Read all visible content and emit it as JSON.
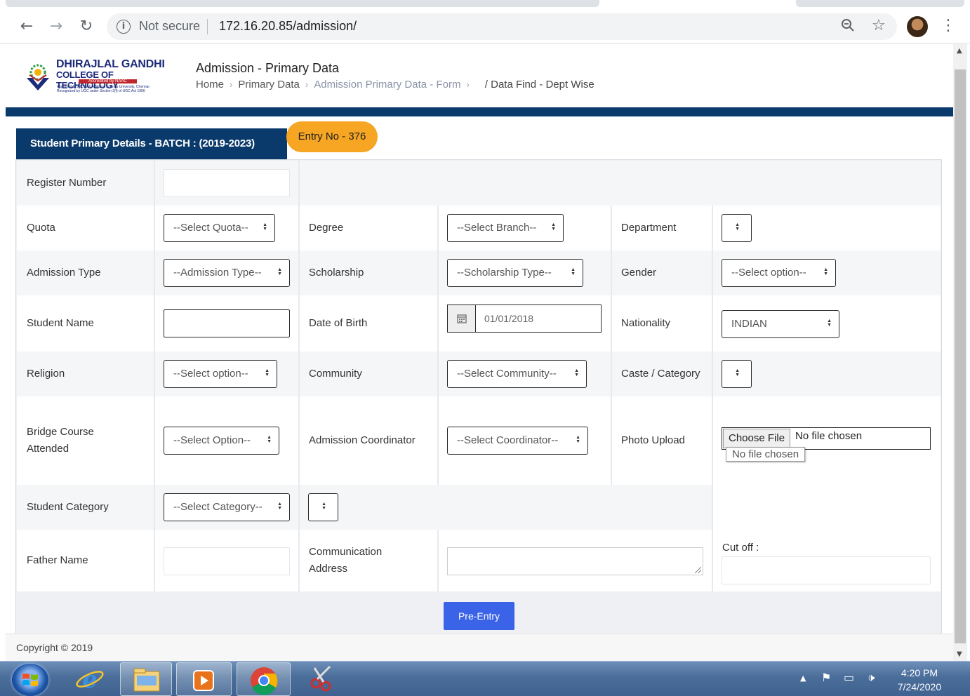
{
  "browser": {
    "security_label": "Not secure",
    "url": "172.16.20.85/admission/"
  },
  "header": {
    "logo": {
      "line1": "DHIRAJLAL GANDHI",
      "line2": "COLLEGE OF TECHNOLOGY",
      "badge": "Accredited by NAAC",
      "fine1": "Approved by AICTE & Affiliated to Anna University, Chennai",
      "fine2": "Recognized by UGC under Section 2(f) of UGC Act 1956"
    },
    "title": "Admission - Primary Data",
    "breadcrumb": {
      "home": "Home",
      "primary": "Primary Data",
      "form": "Admission Primary Data - Form",
      "current": "/ Data Find - Dept Wise"
    }
  },
  "form": {
    "tab_title": "Student Primary Details - BATCH : (2019-2023)",
    "entry_label": "Entry No - 376",
    "fields": {
      "register_number": {
        "label": "Register Number"
      },
      "quota": {
        "label": "Quota",
        "value": "--Select Quota--"
      },
      "degree": {
        "label": "Degree",
        "value": "--Select Branch--"
      },
      "department": {
        "label": "Department",
        "value": ""
      },
      "admission_type": {
        "label": "Admission Type",
        "value": "--Admission Type--"
      },
      "scholarship": {
        "label": "Scholarship",
        "value": "--Scholarship Type--"
      },
      "gender": {
        "label": "Gender",
        "value": "--Select option--"
      },
      "student_name": {
        "label": "Student Name"
      },
      "dob": {
        "label": "Date of Birth",
        "value": "01/01/2018"
      },
      "nationality": {
        "label": "Nationality",
        "value": "INDIAN"
      },
      "religion": {
        "label": "Religion",
        "value": "--Select option--"
      },
      "community": {
        "label": "Community",
        "value": "--Select Community--"
      },
      "caste": {
        "label": "Caste / Category",
        "value": ""
      },
      "bridge_course": {
        "label_line1": "Bridge Course",
        "label_line2": "Attended",
        "value": "--Select Option--"
      },
      "coordinator": {
        "label": "Admission Coordinator",
        "value": "--Select Coordinator--"
      },
      "photo": {
        "label": "Photo Upload",
        "button": "Choose File",
        "status": "No file chosen",
        "tooltip": "No file chosen"
      },
      "student_category": {
        "label": "Student Category",
        "value": "--Select Category--"
      },
      "father_name": {
        "label": "Father Name"
      },
      "address": {
        "label_line1": "Communication",
        "label_line2": "Address"
      },
      "cutoff": {
        "label": "Cut off :"
      }
    },
    "submit_label": "Pre-Entry"
  },
  "footer": {
    "copyright": "Copyright © 2019"
  },
  "taskbar": {
    "time": "4:20 PM",
    "date": "7/24/2020"
  },
  "colors": {
    "brand_navy": "#0a3a6b",
    "entry_orange": "#f6a623",
    "button_blue": "#3b63e8"
  }
}
